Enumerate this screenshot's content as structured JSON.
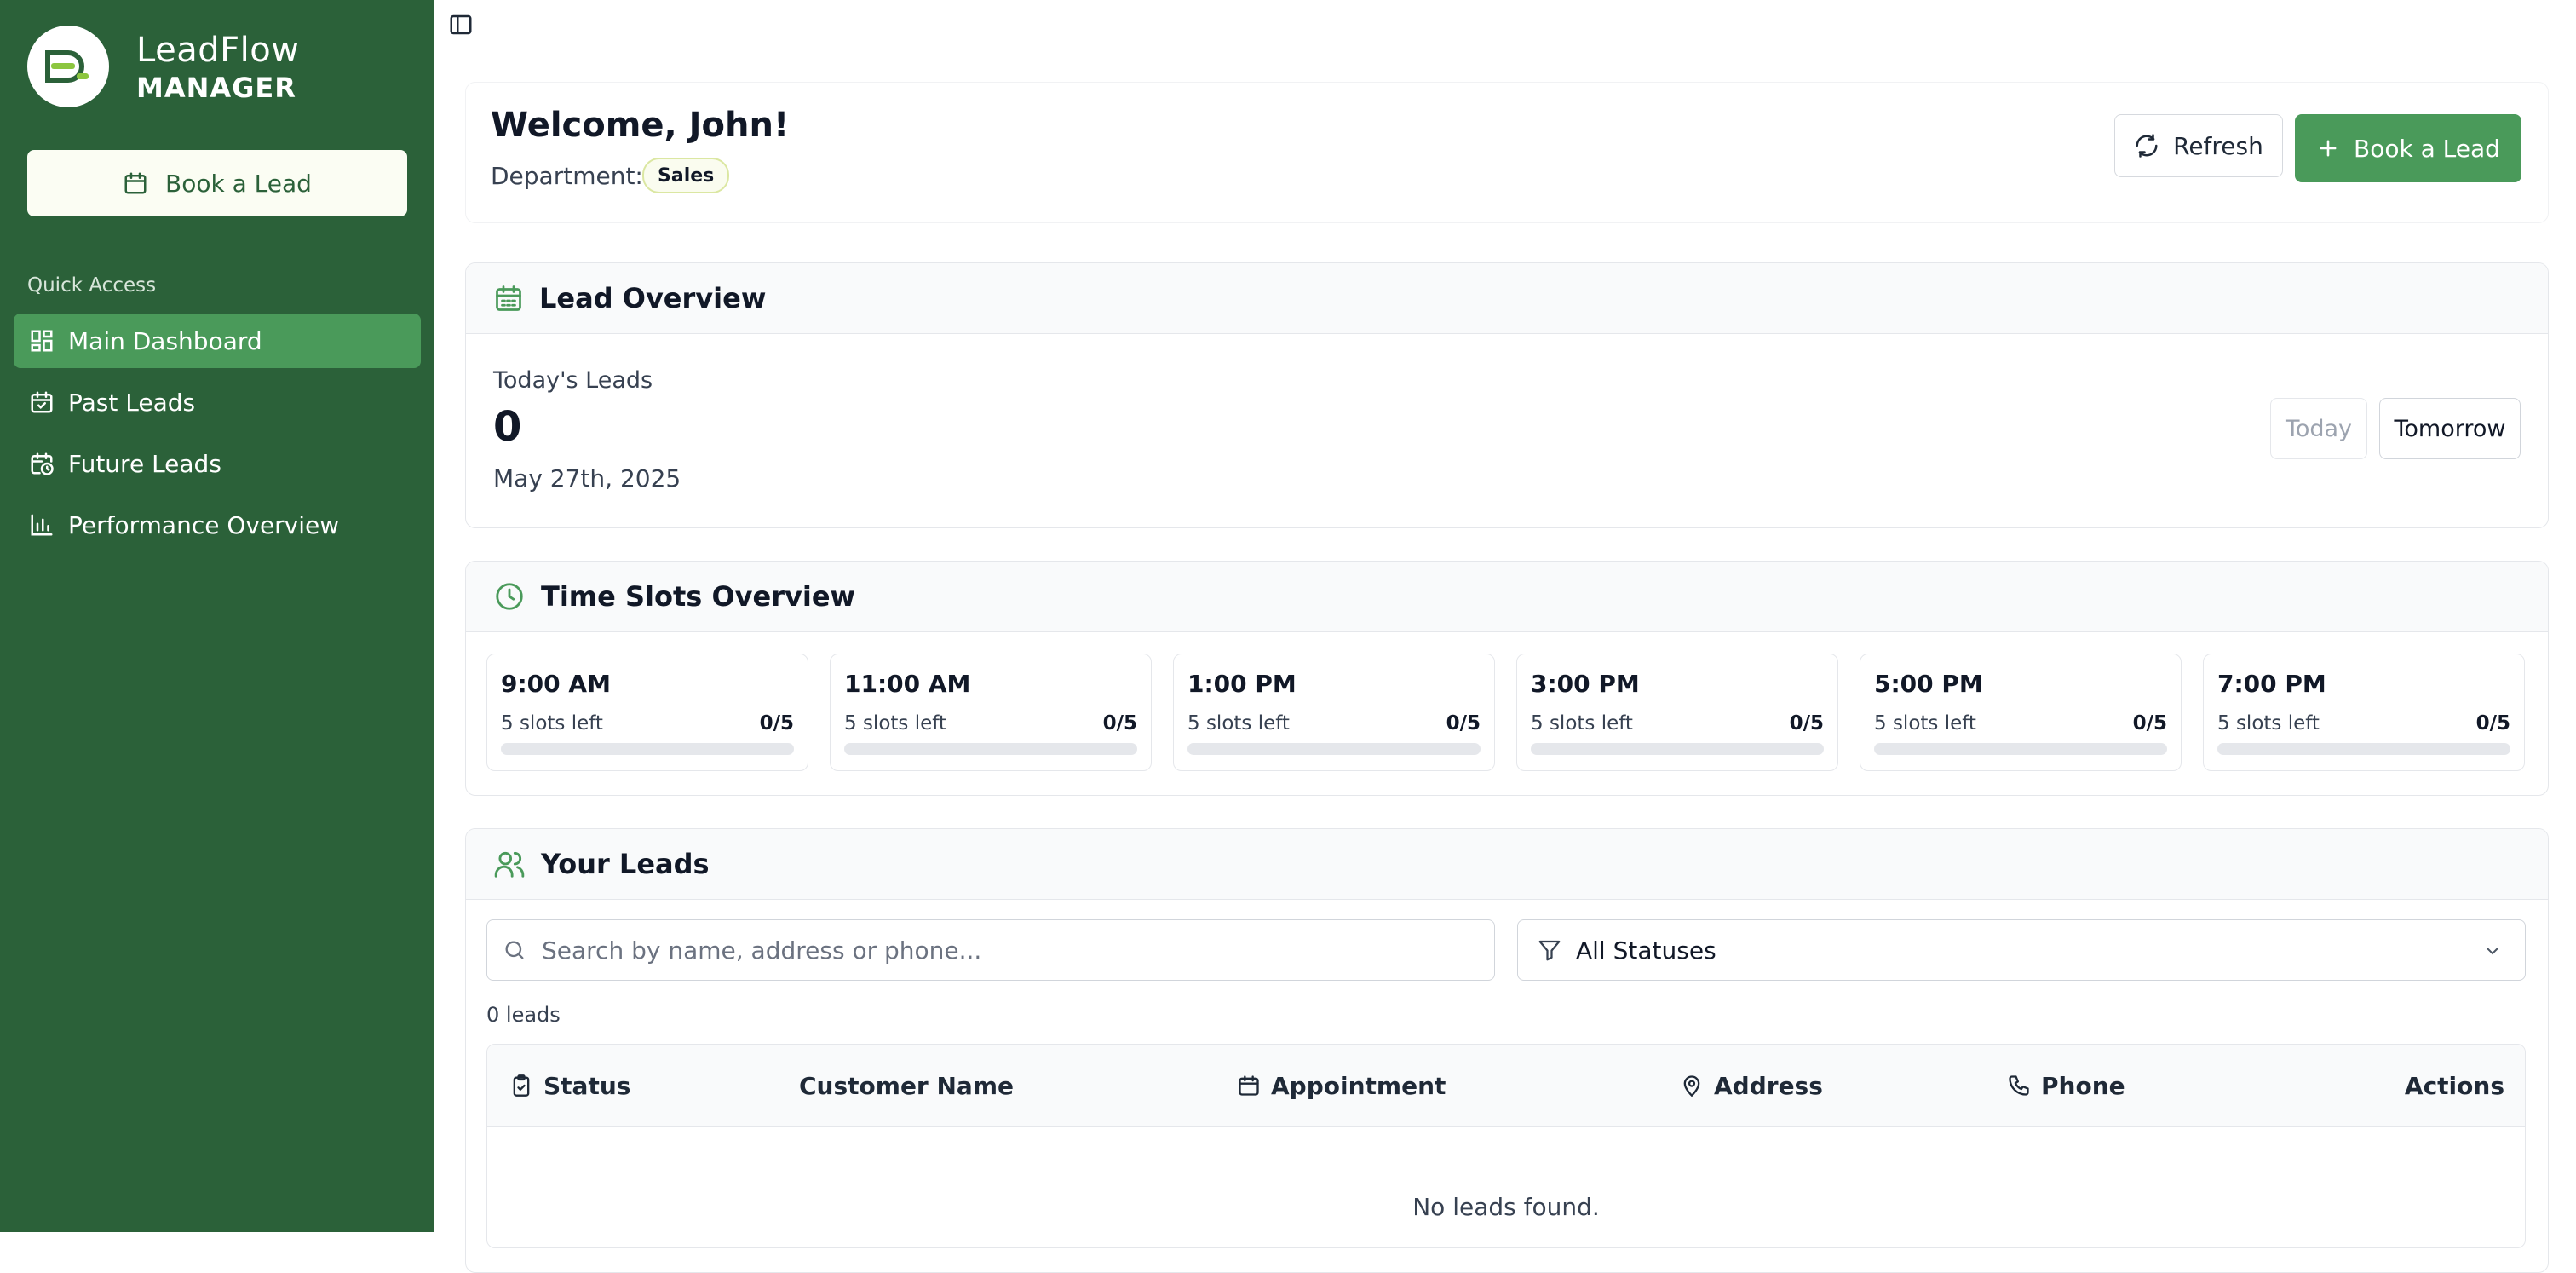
{
  "sidebar": {
    "brand_line1": "LeadFlow",
    "brand_line2": "MANAGER",
    "book_button": "Book a Lead",
    "quick_access_label": "Quick Access",
    "items": [
      {
        "label": "Main Dashboard",
        "icon": "dashboard-icon",
        "active": true
      },
      {
        "label": "Past Leads",
        "icon": "calendar-check-icon",
        "active": false
      },
      {
        "label": "Future Leads",
        "icon": "calendar-clock-icon",
        "active": false
      },
      {
        "label": "Performance Overview",
        "icon": "bar-chart-icon",
        "active": false
      }
    ]
  },
  "header": {
    "welcome": "Welcome, John!",
    "department_label": "Department:",
    "department": "Sales",
    "refresh_button": "Refresh",
    "book_button": "Book a Lead"
  },
  "lead_overview": {
    "title": "Lead Overview",
    "todays_leads_label": "Today's Leads",
    "count": "0",
    "date": "May 27th, 2025",
    "today_button": "Today",
    "tomorrow_button": "Tomorrow"
  },
  "time_slots": {
    "title": "Time Slots Overview",
    "slots": [
      {
        "time": "9:00 AM",
        "left": "5 slots left",
        "count": "0/5",
        "fill": 0
      },
      {
        "time": "11:00 AM",
        "left": "5 slots left",
        "count": "0/5",
        "fill": 0
      },
      {
        "time": "1:00 PM",
        "left": "5 slots left",
        "count": "0/5",
        "fill": 0
      },
      {
        "time": "3:00 PM",
        "left": "5 slots left",
        "count": "0/5",
        "fill": 0
      },
      {
        "time": "5:00 PM",
        "left": "5 slots left",
        "count": "0/5",
        "fill": 0
      },
      {
        "time": "7:00 PM",
        "left": "5 slots left",
        "count": "0/5",
        "fill": 0
      }
    ]
  },
  "your_leads": {
    "title": "Your Leads",
    "search_placeholder": "Search by name, address or phone...",
    "status_filter": "All Statuses",
    "count_text": "0 leads",
    "columns": {
      "status": "Status",
      "customer_name": "Customer Name",
      "appointment": "Appointment",
      "address": "Address",
      "phone": "Phone",
      "actions": "Actions"
    },
    "empty_text": "No leads found."
  },
  "colors": {
    "sidebar_bg": "#2b6139",
    "accent": "#4a9a5a",
    "badge_border": "#dbe7a2"
  }
}
